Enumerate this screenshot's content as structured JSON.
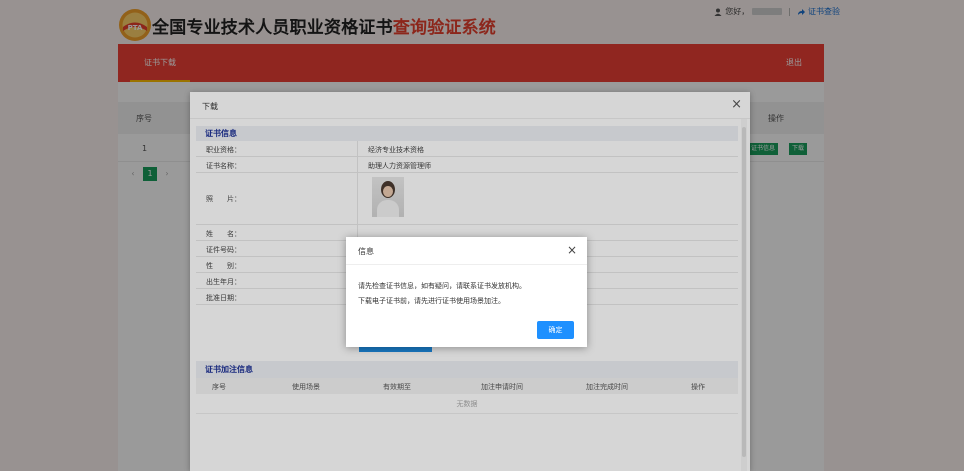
{
  "header": {
    "logo_text": "PTA",
    "title_main": "全国专业技术人员职业资格证书",
    "title_suffix": "查询验证系统",
    "greeting": "您好，",
    "separator": "|",
    "cert_verify_link": "证书查验"
  },
  "nav": {
    "tab_download": "证书下载",
    "logout": "退出"
  },
  "background_table": {
    "col_seq": "序号",
    "col_ops": "操作",
    "row": {
      "seq": "1",
      "btn_info": "证书信息",
      "btn_download": "下载"
    },
    "pager": {
      "prev": "‹",
      "current": "1",
      "next": "›"
    }
  },
  "download_modal": {
    "title": "下载",
    "close": "×",
    "cert_info_title": "证书信息",
    "fields": {
      "qualification_label": "职业资格：",
      "qualification_value": "经济专业技术资格",
      "cert_name_label": "证书名称：",
      "cert_name_value": "助理人力资源管理师",
      "photo_label": "照　　片：",
      "name_label": "姓　　名：",
      "id_label": "证件号码：",
      "gender_label": "性　　别：",
      "birth_label": "出生年月：",
      "approve_label": "批准日期："
    },
    "annotation_title": "证书加注信息",
    "annotation_cols": {
      "seq": "序号",
      "scene": "使用场景",
      "valid": "有效期至",
      "apply_time": "加注申请时间",
      "finish_time": "加注完成时间",
      "ops": "操作"
    },
    "empty_text": "无数据"
  },
  "info_modal": {
    "title": "信息",
    "close": "×",
    "message_line1": "请先检查证书信息，如有疑问，请联系证书发放机构。",
    "message_line2": "下载电子证书前，请先进行证书使用场景加注。",
    "ok_label": "确定"
  },
  "colors": {
    "brand_red": "#ef4136",
    "tab_underline": "#ffc000",
    "primary_blue": "#1e90ff",
    "action_green": "#19a05e",
    "section_title_blue": "#1b2f96"
  }
}
